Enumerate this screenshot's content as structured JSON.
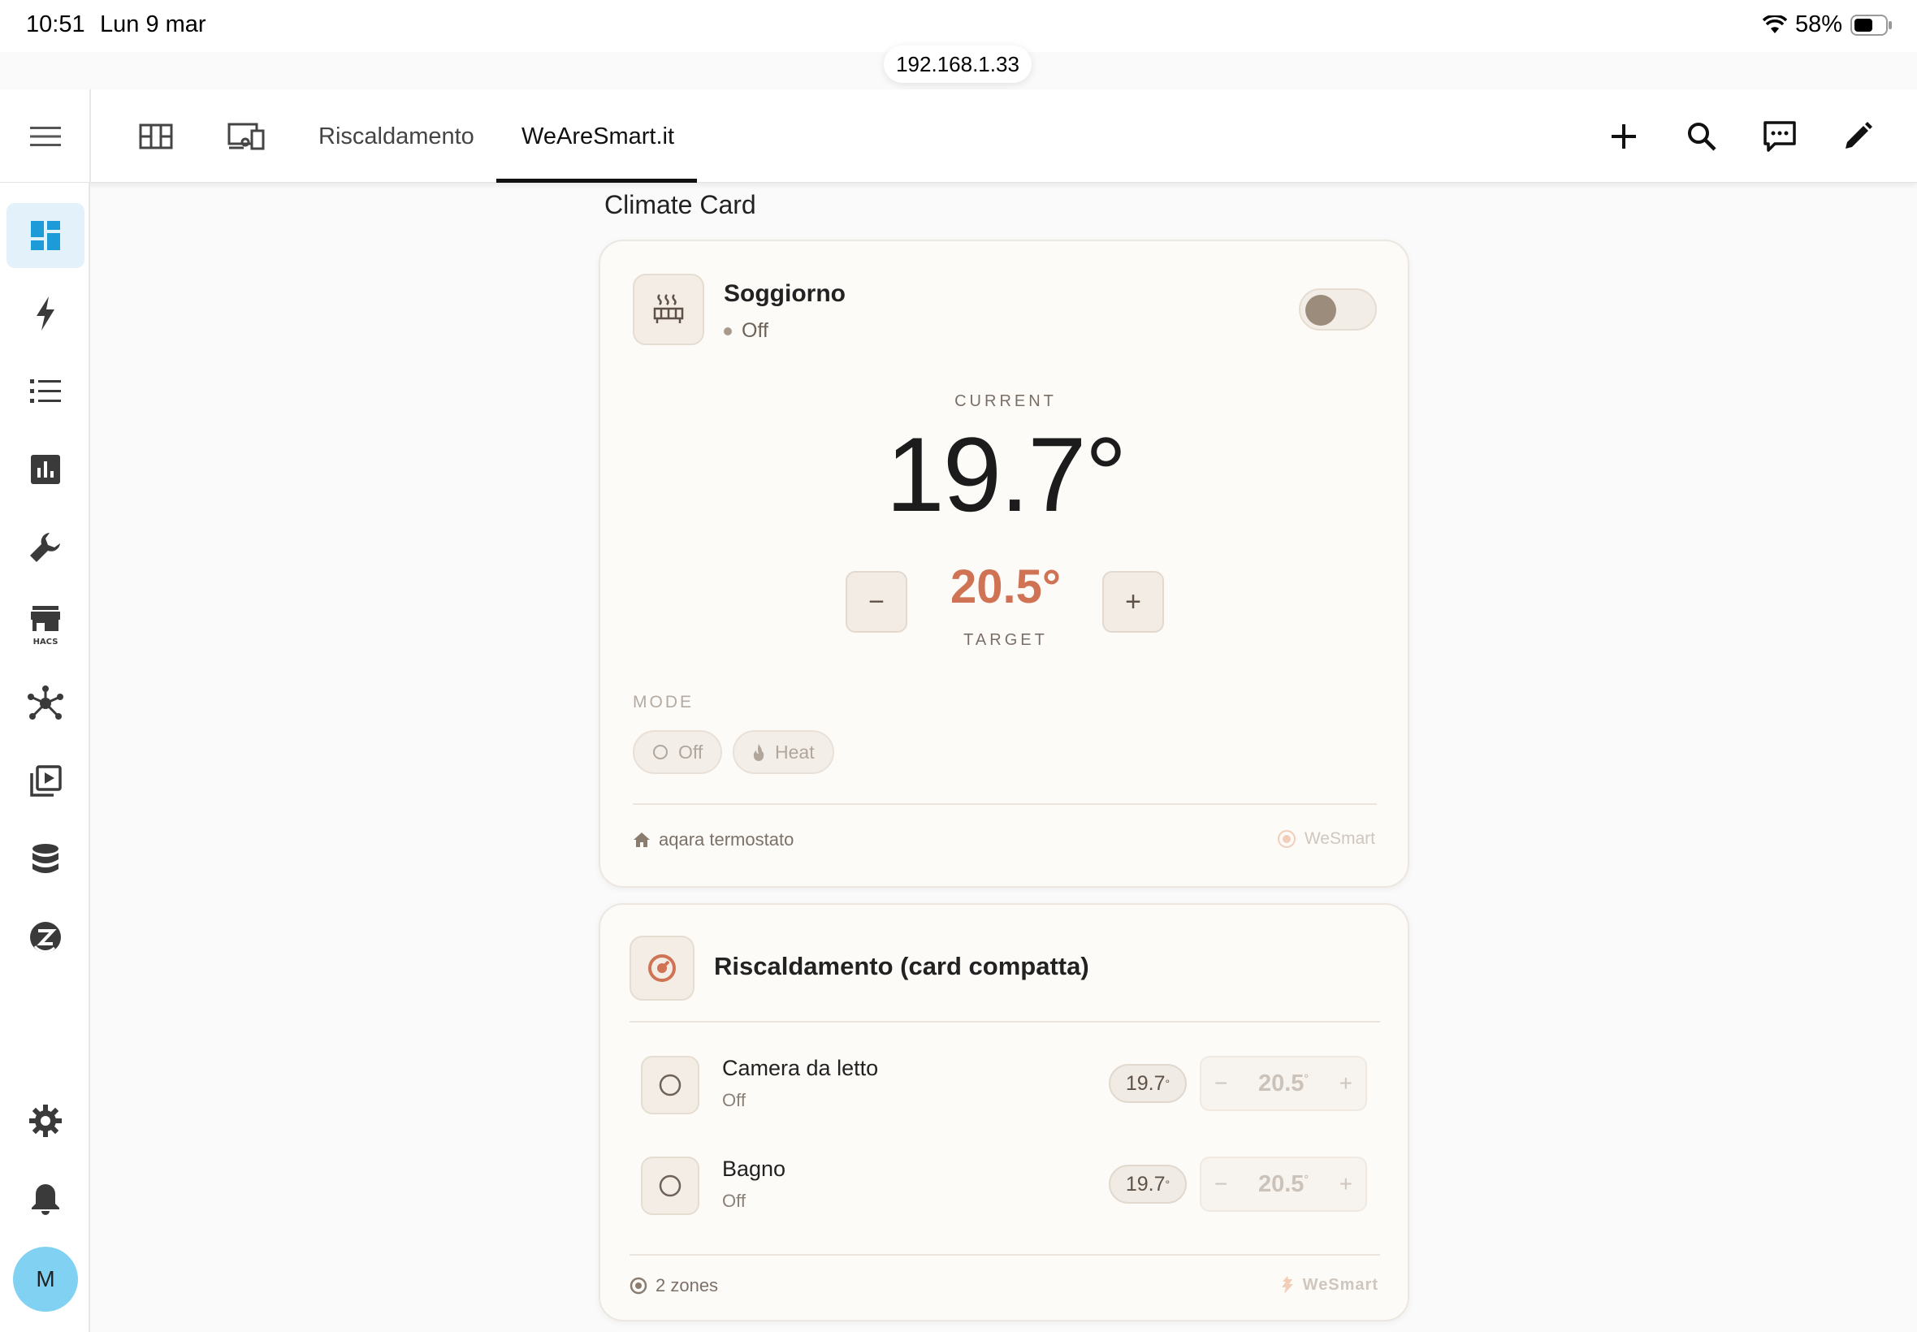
{
  "status_bar": {
    "time": "10:51",
    "date": "Lun 9 mar",
    "battery": "58%",
    "url": "192.168.1.33"
  },
  "topbar": {
    "tabs": [
      {
        "icon": "dashboard-grid-icon"
      },
      {
        "icon": "devices-icon"
      },
      {
        "label": "Riscaldamento"
      },
      {
        "label": "WeAreSmart.it",
        "active": true
      }
    ],
    "actions": [
      "add-icon",
      "search-icon",
      "assist-icon",
      "edit-icon"
    ]
  },
  "sidebar": {
    "items": [
      "overview-icon",
      "energy-icon",
      "logbook-icon",
      "history-icon",
      "developer-tools-icon",
      "hacs-icon",
      "integrations-icon",
      "media-icon",
      "database-icon",
      "zwave-icon"
    ],
    "bottom_items": [
      "settings-icon",
      "notifications-icon"
    ],
    "avatar_initial": "M",
    "hacs_label": "HACS"
  },
  "section_title": "Climate Card",
  "climate_card": {
    "name": "Soggiorno",
    "state": "Off",
    "current_label": "CURRENT",
    "current_value": "19.7°",
    "target_value": "20.5°",
    "target_label": "TARGET",
    "minus": "−",
    "plus": "+",
    "mode_label": "MODE",
    "modes": [
      "Off",
      "Heat"
    ],
    "footer_left": "aqara termostato",
    "footer_right": "WeSmart",
    "toggle_on": false
  },
  "compact_card": {
    "title": "Riscaldamento (card compatta)",
    "zones": [
      {
        "name": "Camera da letto",
        "state": "Off",
        "current": "19.7",
        "target": "20.5"
      },
      {
        "name": "Bagno",
        "state": "Off",
        "current": "19.7",
        "target": "20.5"
      }
    ],
    "deg": "°",
    "footer_left": "2 zones",
    "footer_right": "WeSmart"
  },
  "colors": {
    "accent": "#d07355",
    "sidebar_active": "#e3f1fb",
    "sidebar_icon": "#3a3a3a",
    "overview_icon": "#1d9bd8"
  }
}
